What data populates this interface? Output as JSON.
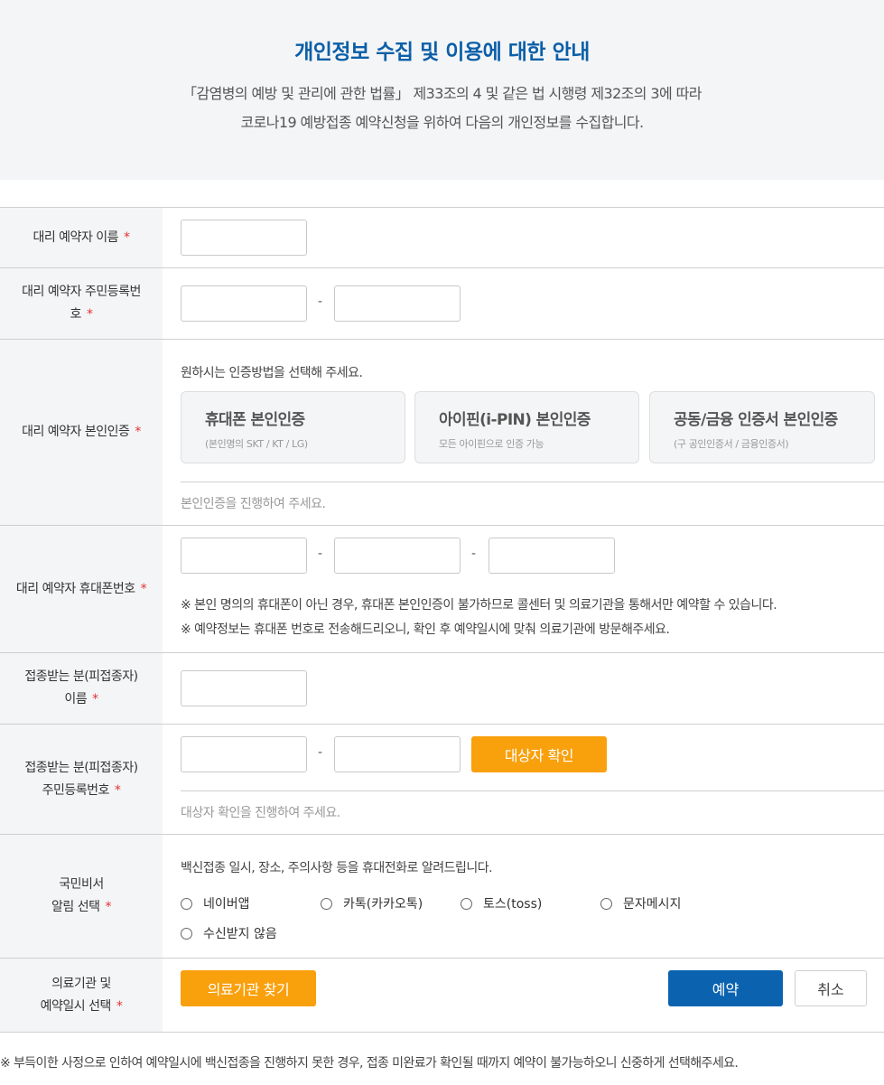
{
  "hero": {
    "title": "개인정보 수집 및 이용에 대한 안내",
    "line1": "「감염병의 예방 및 관리에 관한 법률」 제33조의 4 및 같은 법 시행령 제32조의 3에 따라",
    "line2": "코로나19 예방접종 예약신청을 위하여 다음의 개인정보를 수집합니다."
  },
  "required_mark": "*",
  "dash": "-",
  "proxy_name": {
    "label": "대리 예약자 이름"
  },
  "proxy_rrn": {
    "label_line1": "대리 예약자 주민등록번",
    "label_line2": "호"
  },
  "proxy_auth": {
    "label": "대리 예약자 본인인증",
    "instruction": "원하시는 인증방법을 선택해 주세요.",
    "methods": [
      {
        "title": "휴대폰 본인인증",
        "sub": "(본인명의 SKT / KT / LG)"
      },
      {
        "title": "아이핀(i-PIN) 본인인증",
        "sub": "모든 아이핀으로 인증 가능"
      },
      {
        "title": "공동/금융 인증서 본인인증",
        "sub": "(구 공인인증서 / 금융인증서)"
      }
    ],
    "status": "본인인증을 진행하여 주세요."
  },
  "proxy_phone": {
    "label": "대리 예약자 휴대폰번호",
    "note1": "※ 본인 명의의 휴대폰이 아닌 경우, 휴대폰 본인인증이 불가하므로 콜센터 및 의료기관을 통해서만 예약할 수 있습니다.",
    "note2": "※ 예약정보는 휴대폰 번호로 전송해드리오니, 확인 후 예약일시에 맞춰 의료기관에 방문해주세요."
  },
  "vaccinee_name": {
    "label_line1": "접종받는 분(피접종자)",
    "label_line2": "이름"
  },
  "vaccinee_rrn": {
    "label_line1": "접종받는 분(피접종자)",
    "label_line2": "주민등록번호",
    "confirm_button": "대상자 확인",
    "status": "대상자 확인을 진행하여 주세요."
  },
  "notify": {
    "label_line1": "국민비서",
    "label_line2": "알림 선택",
    "instruction": "백신접종 일시, 장소, 주의사항 등을 휴대전화로 알려드립니다.",
    "options": [
      "네이버앱",
      "카톡(카카오톡)",
      "토스(toss)",
      "문자메시지",
      "수신받지 않음"
    ]
  },
  "hospital": {
    "label_line1": "의료기관 및",
    "label_line2": "예약일시 선택",
    "find_button": "의료기관 찾기",
    "reserve_button": "예약",
    "cancel_button": "취소"
  },
  "footer_note": "※ 부득이한 사정으로 인하여 예약일시에 백신접종을 진행하지 못한 경우, 접종 미완료가 확인될 때까지 예약이 불가능하오니 신중하게 선택해주세요.",
  "colors": {
    "accent_blue": "#0b63b0",
    "title_blue": "#0b5fa8",
    "accent_orange": "#f9a00d",
    "required_red": "#e53030"
  }
}
